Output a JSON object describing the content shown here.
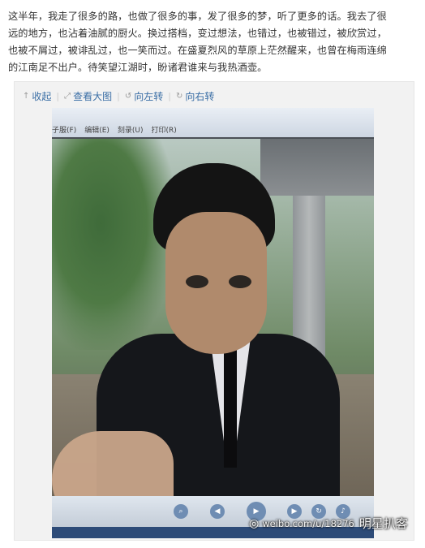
{
  "post": {
    "lines": [
      "这半年，我走了很多的路，也做了很多的事，发了很多的梦，听了更多的话。我去了很",
      "远的地方，也沾着油腻的厨火。换过搭档，变过想法，也错过，也被错过，被欣赏过，",
      "也被不屑过，被诽乱过，也一笑而过。在盛夏烈风的草原上茫然醒来，也曾在梅雨连绵",
      "的江南足不出户。待笑望江湖时，盼诸君谁来与我热酒壶。"
    ]
  },
  "toolbar": {
    "collapse": {
      "label": "收起",
      "icon": "up-arrow-icon"
    },
    "view_large": {
      "label": "查看大图",
      "icon": "external-link-icon"
    },
    "rotate_left": {
      "label": "向左转",
      "icon": "rotate-left-icon"
    },
    "rotate_right": {
      "label": "向右转",
      "icon": "rotate-right-icon"
    }
  },
  "photo": {
    "monitor_menu": [
      "子服(F)",
      "编辑(E)",
      "刻录(U)",
      "打印(R)"
    ],
    "player_controls": [
      "search-icon",
      "previous-icon",
      "play-icon",
      "next-icon",
      "repeat-icon",
      "volume-icon"
    ],
    "watermark_url": "weibo.com/u/18276",
    "watermark_brand": "明星扒客"
  },
  "colors": {
    "link": "#3a6ea5",
    "text": "#333333",
    "box_background": "#f2f2f2"
  }
}
